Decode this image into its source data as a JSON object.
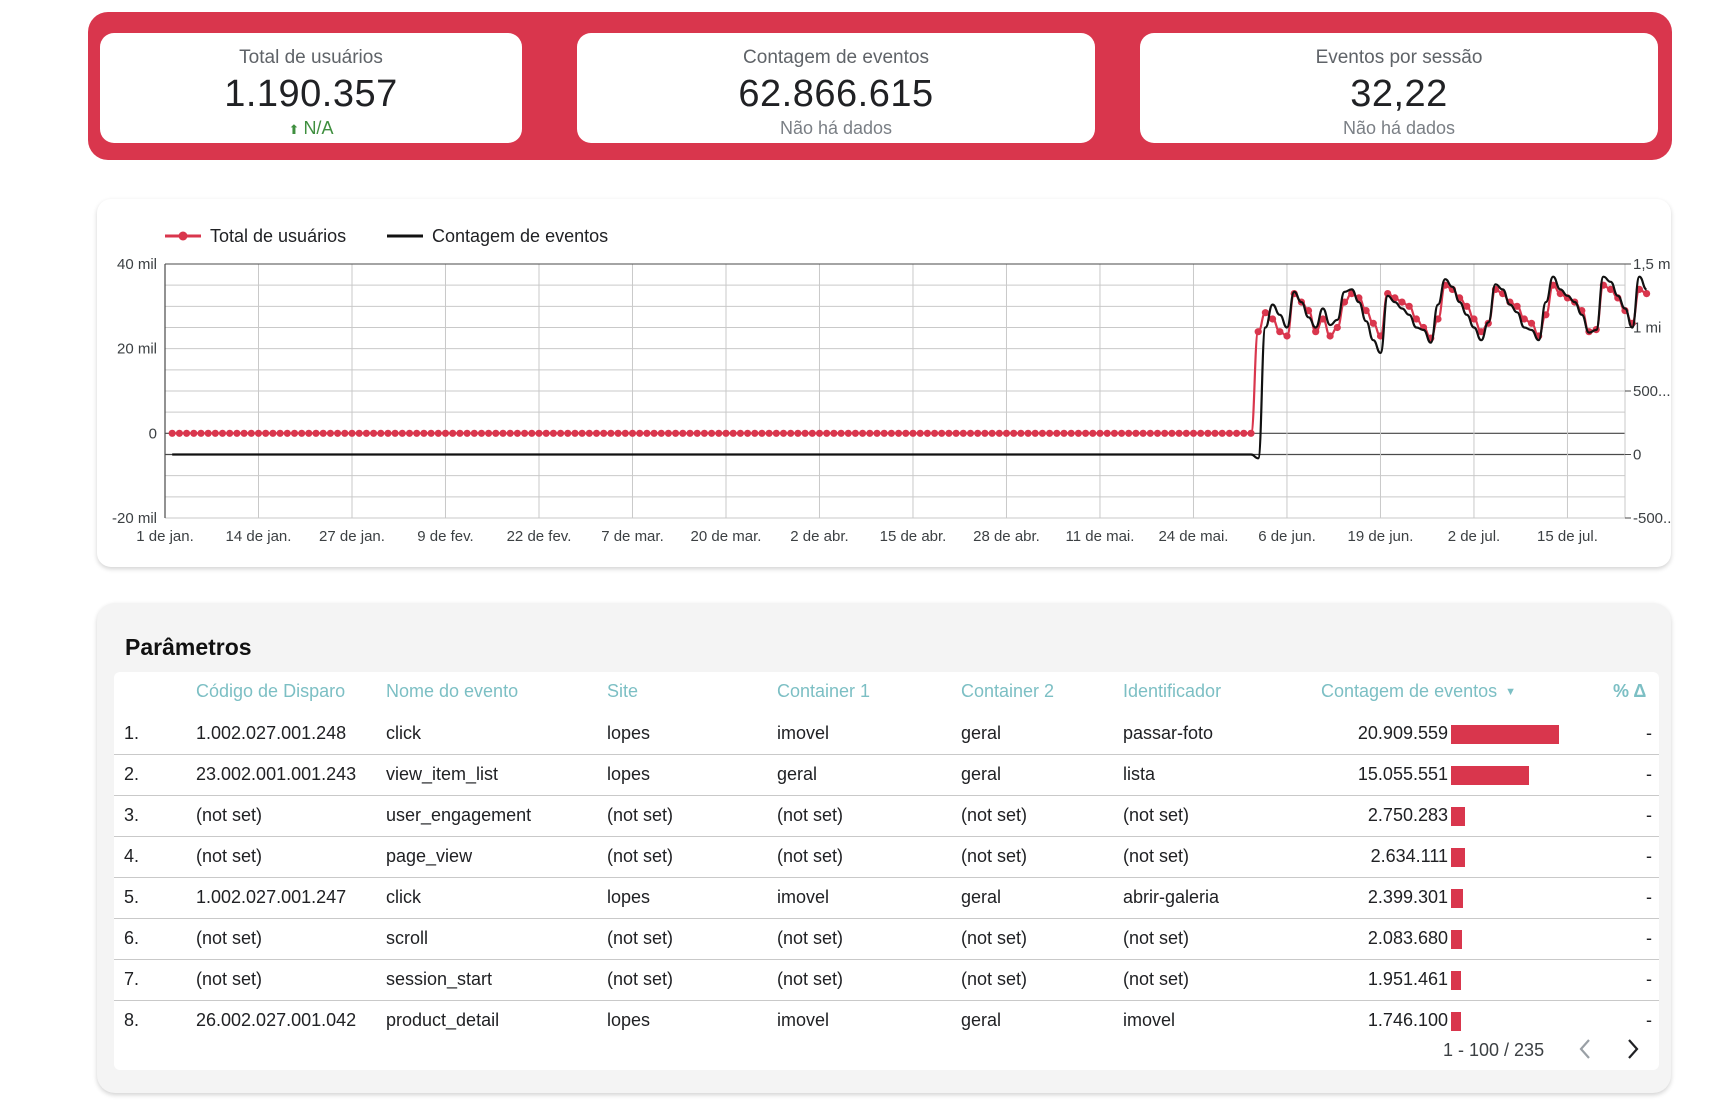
{
  "kpis": [
    {
      "label": "Total de usuários",
      "value": "1.190.357",
      "delta": "N/A",
      "delta_icon": "up-arrow-icon"
    },
    {
      "label": "Contagem de eventos",
      "value": "62.866.615",
      "delta": "Não há dados"
    },
    {
      "label": "Eventos por sessão",
      "value": "32,22",
      "delta": "Não há dados"
    }
  ],
  "colors": {
    "accent": "#d9364d",
    "header_text": "#7cbfc4",
    "up": "#3f8f3f"
  },
  "chart_data": {
    "type": "line",
    "legend": [
      "Total de usuários",
      "Contagem de eventos"
    ],
    "x_tick_labels": [
      "1 de jan.",
      "14 de jan.",
      "27 de jan.",
      "9 de fev.",
      "22 de fev.",
      "7 de mar.",
      "20 de mar.",
      "2 de abr.",
      "15 de abr.",
      "28 de abr.",
      "11 de mai.",
      "24 de mai.",
      "6 de jun.",
      "19 de jun.",
      "2 de jul.",
      "15 de jul."
    ],
    "y_left_ticks": [
      "40 mil",
      "20 mil",
      "0",
      "-20 mil"
    ],
    "y_right_ticks": [
      "1,5 mi",
      "1 mi",
      "500...",
      "0",
      "-500..."
    ],
    "y_left_range": [
      -20000,
      40000
    ],
    "y_right_range": [
      -500000,
      1500000
    ],
    "x_range": [
      "2024-01-01",
      "2024-07-22"
    ],
    "grid": true,
    "legend_position": "top-left",
    "series": [
      {
        "name": "Total de usuários",
        "axis": "left",
        "color": "#d9364d",
        "markers": true,
        "x_start": "2024-01-01",
        "values": [
          0,
          0,
          0,
          0,
          0,
          0,
          0,
          0,
          0,
          0,
          0,
          0,
          0,
          0,
          0,
          0,
          0,
          0,
          0,
          0,
          0,
          0,
          0,
          0,
          0,
          0,
          0,
          0,
          0,
          0,
          0,
          0,
          0,
          0,
          0,
          0,
          0,
          0,
          0,
          0,
          0,
          0,
          0,
          0,
          0,
          0,
          0,
          0,
          0,
          0,
          0,
          0,
          0,
          0,
          0,
          0,
          0,
          0,
          0,
          0,
          0,
          0,
          0,
          0,
          0,
          0,
          0,
          0,
          0,
          0,
          0,
          0,
          0,
          0,
          0,
          0,
          0,
          0,
          0,
          0,
          0,
          0,
          0,
          0,
          0,
          0,
          0,
          0,
          0,
          0,
          0,
          0,
          0,
          0,
          0,
          0,
          0,
          0,
          0,
          0,
          0,
          0,
          0,
          0,
          0,
          0,
          0,
          0,
          0,
          0,
          0,
          0,
          0,
          0,
          0,
          0,
          0,
          0,
          0,
          0,
          0,
          0,
          0,
          0,
          0,
          0,
          0,
          0,
          0,
          0,
          0,
          0,
          0,
          0,
          0,
          0,
          0,
          0,
          0,
          0,
          0,
          0,
          0,
          0,
          0,
          0,
          0,
          0,
          0,
          0,
          0,
          24000,
          28500,
          27000,
          24000,
          23000,
          33000,
          31000,
          29000,
          24000,
          27000,
          23000,
          25000,
          31000,
          33000,
          32000,
          29000,
          26000,
          23000,
          33000,
          32000,
          31000,
          30000,
          27000,
          25000,
          22500,
          27000,
          35000,
          34000,
          32000,
          30000,
          27000,
          24000,
          26000,
          34000,
          33000,
          31000,
          30000,
          27000,
          26000,
          23000,
          28000,
          35000,
          33000,
          32000,
          31000,
          29000,
          24000,
          24500,
          35000,
          34000,
          32000,
          29000,
          26000,
          34000,
          33000
        ]
      },
      {
        "name": "Contagem de eventos",
        "axis": "right",
        "color": "#111111",
        "markers": false,
        "x_start": "2024-01-01",
        "values": [
          0,
          0,
          0,
          0,
          0,
          0,
          0,
          0,
          0,
          0,
          0,
          0,
          0,
          0,
          0,
          0,
          0,
          0,
          0,
          0,
          0,
          0,
          0,
          0,
          0,
          0,
          0,
          0,
          0,
          0,
          0,
          0,
          0,
          0,
          0,
          0,
          0,
          0,
          0,
          0,
          0,
          0,
          0,
          0,
          0,
          0,
          0,
          0,
          0,
          0,
          0,
          0,
          0,
          0,
          0,
          0,
          0,
          0,
          0,
          0,
          0,
          0,
          0,
          0,
          0,
          0,
          0,
          0,
          0,
          0,
          0,
          0,
          0,
          0,
          0,
          0,
          0,
          0,
          0,
          0,
          0,
          0,
          0,
          0,
          0,
          0,
          0,
          0,
          0,
          0,
          0,
          0,
          0,
          0,
          0,
          0,
          0,
          0,
          0,
          0,
          0,
          0,
          0,
          0,
          0,
          0,
          0,
          0,
          0,
          0,
          0,
          0,
          0,
          0,
          0,
          0,
          0,
          0,
          0,
          0,
          0,
          0,
          0,
          0,
          0,
          0,
          0,
          0,
          0,
          0,
          0,
          0,
          0,
          0,
          0,
          0,
          0,
          0,
          0,
          0,
          0,
          0,
          0,
          0,
          0,
          0,
          0,
          0,
          0,
          0,
          0,
          -30000,
          1000000,
          1180000,
          1100000,
          1000000,
          1280000,
          1200000,
          1080000,
          1000000,
          1150000,
          1020000,
          1060000,
          1280000,
          1300000,
          1200000,
          1050000,
          900000,
          800000,
          1250000,
          1200000,
          1150000,
          1100000,
          1000000,
          980000,
          880000,
          1180000,
          1380000,
          1320000,
          1200000,
          1100000,
          1000000,
          900000,
          1040000,
          1340000,
          1300000,
          1180000,
          1120000,
          1000000,
          980000,
          900000,
          1200000,
          1400000,
          1300000,
          1250000,
          1200000,
          1100000,
          960000,
          980000,
          1400000,
          1360000,
          1250000,
          1150000,
          1000000,
          1400000,
          1300000
        ]
      }
    ]
  },
  "table": {
    "title": "Parâmetros",
    "headers": [
      "Código de Disparo",
      "Nome do evento",
      "Site",
      "Container 1",
      "Container 2",
      "Identificador",
      "Contagem de eventos",
      "% Δ"
    ],
    "sort_icon": "sort-desc-icon",
    "rows": [
      {
        "index": "1.",
        "codigo": "1.002.027.001.248",
        "evento": "click",
        "site": "lopes",
        "c1": "imovel",
        "c2": "geral",
        "id": "passar-foto",
        "count": "20.909.559",
        "count_value": 20909559,
        "delta": "-"
      },
      {
        "index": "2.",
        "codigo": "23.002.001.001.243",
        "evento": "view_item_list",
        "site": "lopes",
        "c1": "geral",
        "c2": "geral",
        "id": "lista",
        "count": "15.055.551",
        "count_value": 15055551,
        "delta": "-"
      },
      {
        "index": "3.",
        "codigo": "(not set)",
        "evento": "user_engagement",
        "site": "(not set)",
        "c1": "(not set)",
        "c2": "(not set)",
        "id": "(not set)",
        "count": "2.750.283",
        "count_value": 2750283,
        "delta": "-"
      },
      {
        "index": "4.",
        "codigo": "(not set)",
        "evento": "page_view",
        "site": "(not set)",
        "c1": "(not set)",
        "c2": "(not set)",
        "id": "(not set)",
        "count": "2.634.111",
        "count_value": 2634111,
        "delta": "-"
      },
      {
        "index": "5.",
        "codigo": "1.002.027.001.247",
        "evento": "click",
        "site": "lopes",
        "c1": "imovel",
        "c2": "geral",
        "id": "abrir-galeria",
        "count": "2.399.301",
        "count_value": 2399301,
        "delta": "-"
      },
      {
        "index": "6.",
        "codigo": "(not set)",
        "evento": "scroll",
        "site": "(not set)",
        "c1": "(not set)",
        "c2": "(not set)",
        "id": "(not set)",
        "count": "2.083.680",
        "count_value": 2083680,
        "delta": "-"
      },
      {
        "index": "7.",
        "codigo": "(not set)",
        "evento": "session_start",
        "site": "(not set)",
        "c1": "(not set)",
        "c2": "(not set)",
        "id": "(not set)",
        "count": "1.951.461",
        "count_value": 1951461,
        "delta": "-"
      },
      {
        "index": "8.",
        "codigo": "26.002.027.001.042",
        "evento": "product_detail",
        "site": "lopes",
        "c1": "imovel",
        "c2": "geral",
        "id": "imovel",
        "count": "1.746.100",
        "count_value": 1746100,
        "delta": "-"
      }
    ],
    "pagination": {
      "text": "1 - 100 / 235",
      "prev_icon": "chevron-left-icon",
      "next_icon": "chevron-right-icon"
    }
  }
}
